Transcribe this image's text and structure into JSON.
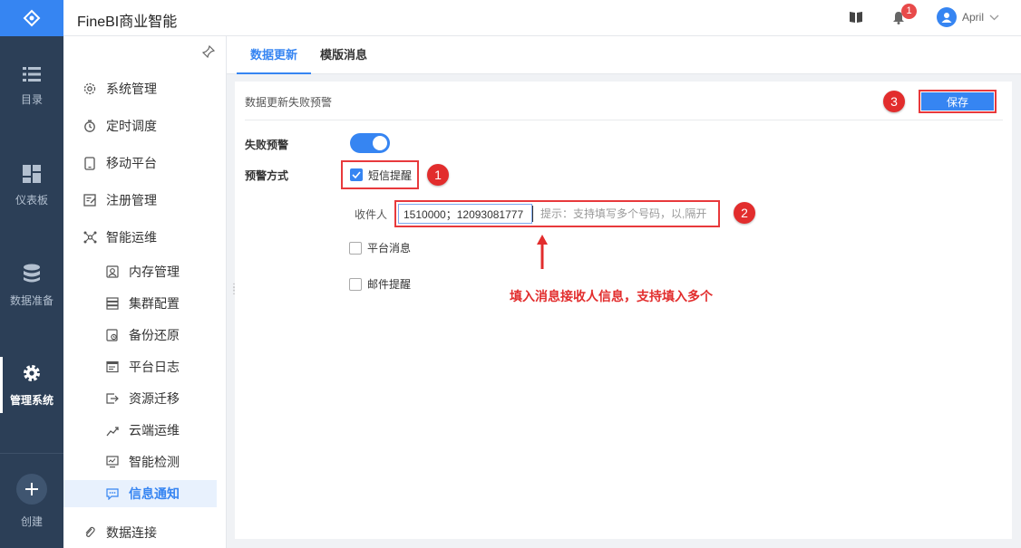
{
  "app": {
    "title": "FineBI商业智能"
  },
  "header": {
    "notification_count": "1",
    "user_name": "April"
  },
  "rail": {
    "items": [
      {
        "label": "目录",
        "icon": "list-icon"
      },
      {
        "label": "仪表板",
        "icon": "dashboard-icon"
      },
      {
        "label": "数据准备",
        "icon": "database-icon"
      },
      {
        "label": "管理系统",
        "icon": "gear-icon"
      }
    ],
    "create_label": "创建"
  },
  "nav": {
    "items": [
      {
        "label": "系统管理"
      },
      {
        "label": "定时调度"
      },
      {
        "label": "移动平台"
      },
      {
        "label": "注册管理"
      },
      {
        "label": "智能运维"
      },
      {
        "label": "内存管理"
      },
      {
        "label": "集群配置"
      },
      {
        "label": "备份还原"
      },
      {
        "label": "平台日志"
      },
      {
        "label": "资源迁移"
      },
      {
        "label": "云端运维"
      },
      {
        "label": "智能检测"
      },
      {
        "label": "信息通知"
      },
      {
        "label": "数据连接"
      }
    ]
  },
  "tabs": [
    {
      "label": "数据更新"
    },
    {
      "label": "模版消息"
    }
  ],
  "panel": {
    "title": "数据更新失败预警",
    "save_label": "保存",
    "fail_alert_label": "失败预警",
    "alert_method_label": "预警方式",
    "sms_label": "短信提醒",
    "recipient_label": "收件人",
    "recipient_value": "1510000；12093081777",
    "recipient_hint": "提示：支持填写多个号码，以,隔开",
    "platform_msg_label": "平台消息",
    "email_label": "邮件提醒"
  },
  "annotations": {
    "step1": "1",
    "step2": "2",
    "step3": "3",
    "note": "填入消息接收人信息，支持填入多个"
  },
  "colors": {
    "accent": "#3685f2",
    "rail": "#2c3f57",
    "highlight": "#e8393c"
  }
}
